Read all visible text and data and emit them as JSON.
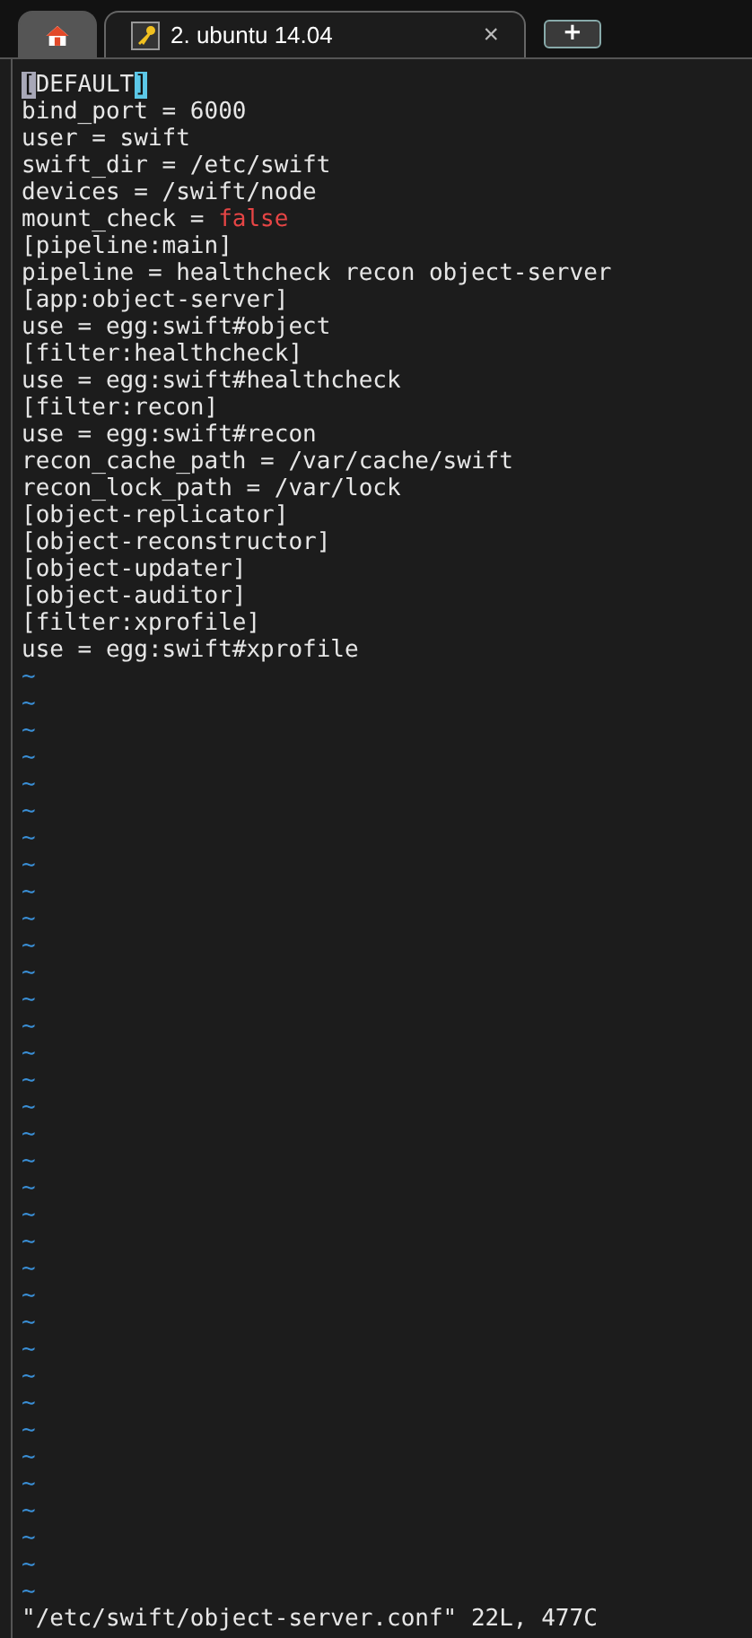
{
  "tabs": [
    {
      "kind": "home",
      "selected": false
    },
    {
      "kind": "session",
      "label": "2. ubuntu 14.04",
      "close": "×",
      "selected": true
    }
  ],
  "new_tab": {
    "label": "+"
  },
  "editor": {
    "lines": [
      [
        {
          "text": "[",
          "kind": "cursor"
        },
        {
          "text": "DEFAULT",
          "kind": "plain"
        },
        {
          "text": "]",
          "kind": "match"
        }
      ],
      [
        {
          "text": "bind_port = 6000",
          "kind": "plain"
        }
      ],
      [
        {
          "text": "user = swift",
          "kind": "plain"
        }
      ],
      [
        {
          "text": "swift_dir = /etc/swift",
          "kind": "plain"
        }
      ],
      [
        {
          "text": "devices = /swift/node",
          "kind": "plain"
        }
      ],
      [
        {
          "text": "mount_check = ",
          "kind": "plain"
        },
        {
          "text": "false",
          "kind": "constant"
        }
      ],
      [
        {
          "text": "[pipeline:main]",
          "kind": "plain"
        }
      ],
      [
        {
          "text": "pipeline = healthcheck recon object-server",
          "kind": "plain"
        }
      ],
      [
        {
          "text": "[app:object-server]",
          "kind": "plain"
        }
      ],
      [
        {
          "text": "use = egg:swift#object",
          "kind": "plain"
        }
      ],
      [
        {
          "text": "[filter:healthcheck]",
          "kind": "plain"
        }
      ],
      [
        {
          "text": "use = egg:swift#healthcheck",
          "kind": "plain"
        }
      ],
      [
        {
          "text": "[filter:recon]",
          "kind": "plain"
        }
      ],
      [
        {
          "text": "use = egg:swift#recon",
          "kind": "plain"
        }
      ],
      [
        {
          "text": "recon_cache_path = /var/cache/swift",
          "kind": "plain"
        }
      ],
      [
        {
          "text": "recon_lock_path = /var/lock",
          "kind": "plain"
        }
      ],
      [
        {
          "text": "[object-replicator]",
          "kind": "plain"
        }
      ],
      [
        {
          "text": "[object-reconstructor]",
          "kind": "plain"
        }
      ],
      [
        {
          "text": "[object-updater]",
          "kind": "plain"
        }
      ],
      [
        {
          "text": "[object-auditor]",
          "kind": "plain"
        }
      ],
      [
        {
          "text": "[filter:xprofile]",
          "kind": "plain"
        }
      ],
      [
        {
          "text": "use = egg:swift#xprofile",
          "kind": "plain"
        }
      ]
    ],
    "empty_lines": [
      "~",
      "~",
      "~",
      "~",
      "~",
      "~",
      "~",
      "~",
      "~",
      "~",
      "~",
      "~",
      "~",
      "~",
      "~",
      "~",
      "~",
      "~",
      "~",
      "~",
      "~",
      "~",
      "~",
      "~",
      "~",
      "~",
      "~",
      "~",
      "~",
      "~",
      "~",
      "~",
      "~",
      "~",
      "~"
    ]
  },
  "status_line": "\"/etc/swift/object-server.conf\" 22L, 477C"
}
